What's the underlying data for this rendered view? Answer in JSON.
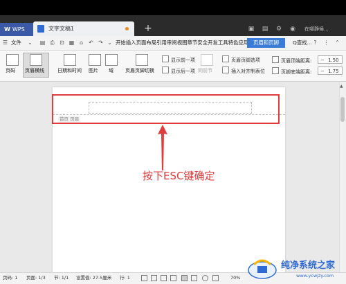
{
  "window": {
    "app_tab": "WPS",
    "doc_tab": "文字文稿1",
    "new_tab_symbol": "+",
    "login_text": "在哪静候..."
  },
  "menu": {
    "file": "文件",
    "items_text": "开始插入页面布局引用审阅视图章节安全开发工具特色应用",
    "active": "页眉和页脚",
    "find": "Q查找..."
  },
  "ribbon": {
    "page_number": "页码",
    "header_line": "页眉横线",
    "datetime": "日期和时间",
    "picture": "图片",
    "field": "域",
    "switch": "页眉页脚切换",
    "show_prev": "显示前一项",
    "show_next": "显示后一项",
    "same_prev": "同前节",
    "hf_options": "页眉页脚选项",
    "align_tab": "插入对齐制表位",
    "header_top_label": "页眉顶端距离:",
    "header_top_value": "1.50",
    "footer_bottom_label": "页脚底端距离:",
    "footer_bottom_value": "1.75"
  },
  "document": {
    "header_tag": "首页 页眉",
    "annotation": "按下ESC键确定"
  },
  "status": {
    "page_num": "页码: 1",
    "pages": "页面: 1/3",
    "section": "节: 1/1",
    "position": "设置值: 27.5厘米",
    "line": "行: 1",
    "zoom": "70%"
  },
  "watermark": {
    "brand": "纯净系统之家",
    "url": "www.ycwjzy.com"
  },
  "colors": {
    "accent": "#3a7bd5",
    "annotation_red": "#e23b3b",
    "brand_blue": "#2f6bd3"
  }
}
